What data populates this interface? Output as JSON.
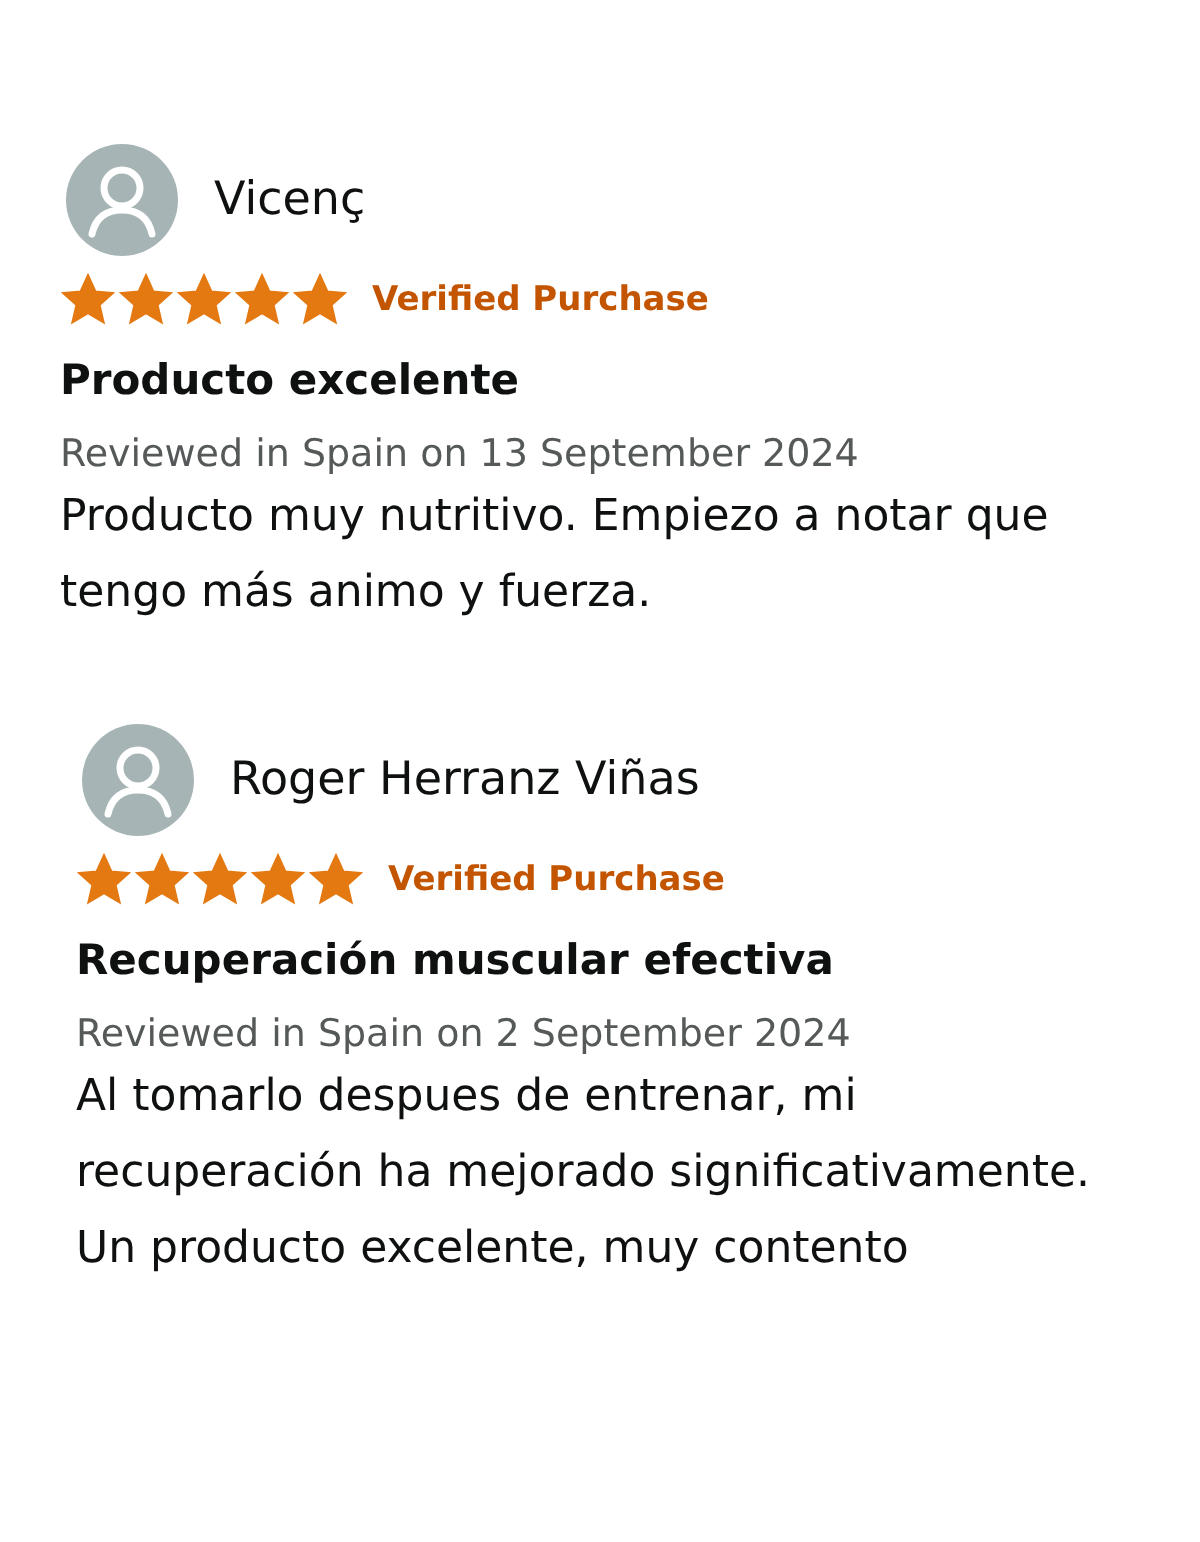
{
  "reviews": [
    {
      "author": "Vicenç",
      "stars": 5,
      "badge": "Verified Purchase",
      "title": "Producto excelente",
      "date": "Reviewed in Spain on 13 September 2024",
      "body": "Producto muy nutritivo. Empiezo a notar que tengo más animo y fuerza."
    },
    {
      "author": "Roger Herranz Viñas",
      "stars": 5,
      "badge": "Verified Purchase",
      "title": "Recuperación muscular efectiva",
      "date": "Reviewed in Spain on 2 September 2024",
      "body": "Al tomarlo despues de entrenar, mi recuperación ha mejorado significativamente. Un producto excelente, muy contento"
    }
  ]
}
